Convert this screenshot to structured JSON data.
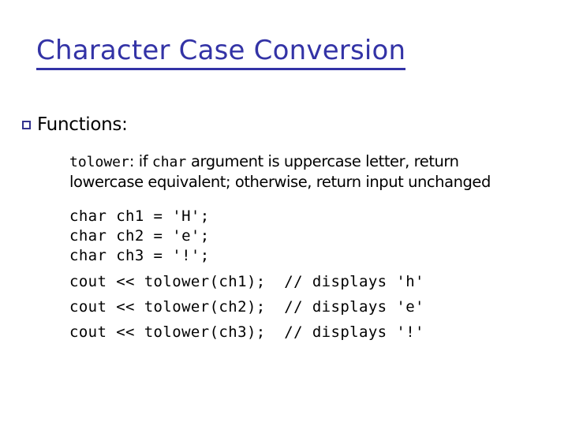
{
  "slide": {
    "title": "Character Case Conversion",
    "title_color": "#3333a6",
    "background_color": "#ffffff",
    "text_color": "#000000",
    "bullet_color": "#33338f"
  },
  "bullet": {
    "icon": "square-bullet-icon",
    "label": "Functions:"
  },
  "description": {
    "func_name": "tolower",
    "part1": ": if ",
    "type_name": "char",
    "part2": " argument is uppercase letter, return lowercase equivalent; otherwise, return input unchanged"
  },
  "code": {
    "declarations": [
      "char ch1 = 'H';",
      "char ch2 = 'e';",
      "char ch3 = '!';"
    ],
    "statements": [
      "cout << tolower(ch1);  // displays 'h'",
      "cout << tolower(ch2);  // displays 'e'",
      "cout << tolower(ch3);  // displays '!'"
    ]
  }
}
